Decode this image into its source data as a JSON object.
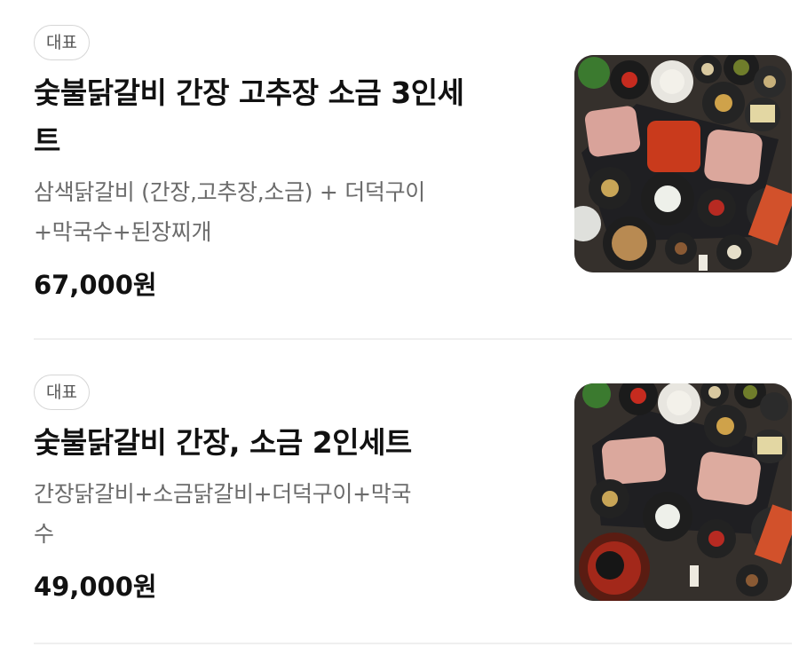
{
  "menu": {
    "items": [
      {
        "badge": "대표",
        "title_line1": "숯불닭갈비 간장 고추장 소금 3인세",
        "title_line2": "트",
        "desc_line1": "삼색닭갈비 (간장,고추장,소금) + 더덕구이",
        "desc_line2": "+막국수+된장찌개",
        "price": "67,000원"
      },
      {
        "badge": "대표",
        "title_line1": "숯불닭갈비 간장, 소금 2인세트",
        "desc_line1": "간장닭갈비+소금닭갈비+더덕구이+막국",
        "desc_line2": "수",
        "price": "49,000원"
      }
    ]
  },
  "colors": {
    "badge_border": "#d6d6d6",
    "desc_text": "#6b6b6b",
    "divider": "#efefef"
  }
}
